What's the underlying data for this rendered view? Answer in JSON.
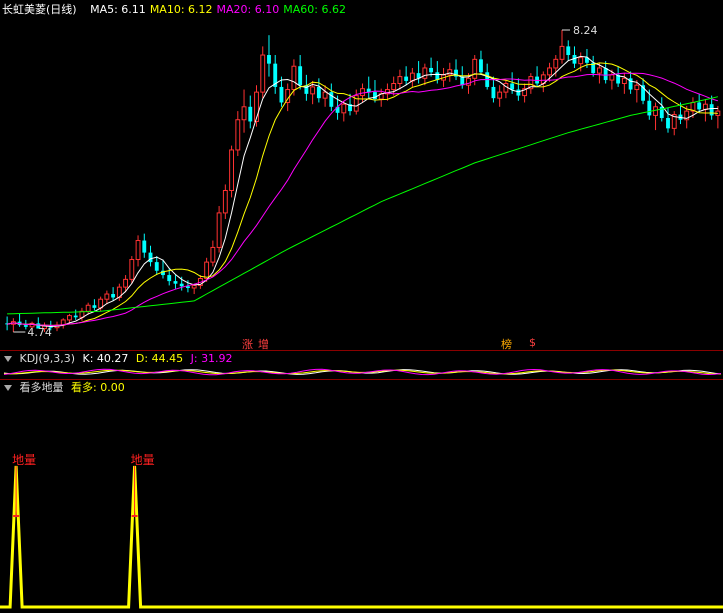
{
  "header": {
    "title": "长虹美菱(日线)",
    "ma": [
      {
        "label": "MA5",
        "value": "6.11",
        "color": "#ffffff"
      },
      {
        "label": "MA10",
        "value": "6.12",
        "color": "#ffff00"
      },
      {
        "label": "MA20",
        "value": "6.10",
        "color": "#ff00ff"
      },
      {
        "label": "MA60",
        "value": "6.62",
        "color": "#00ff00"
      }
    ]
  },
  "kdj": {
    "title": "KDJ(9,3,3)",
    "k": {
      "label": "K",
      "value": "40.27",
      "color": "#ffffff"
    },
    "d": {
      "label": "D",
      "value": "44.45",
      "color": "#ffff00"
    },
    "j": {
      "label": "J",
      "value": "31.92",
      "color": "#ff00ff"
    }
  },
  "indicator": {
    "title": "看多地量",
    "item_label": "看多",
    "item_value": "0.00",
    "signal_label": "地量"
  },
  "chart_data": [
    {
      "type": "candlestick",
      "title": "长虹美菱(日线)",
      "annotations": {
        "high": "8.24",
        "low": "4.74"
      },
      "event_labels": [
        "涨",
        "增",
        "榜",
        "$"
      ],
      "colors": {
        "up": "#ff3232",
        "down": "#00ffff",
        "ma5": "#ffffff",
        "ma10": "#ffff00",
        "ma20": "#ff00ff",
        "ma60": "#00ff00"
      },
      "ma60_approx": [
        [
          0,
          4.95
        ],
        [
          15,
          4.98
        ],
        [
          30,
          5.1
        ],
        [
          45,
          5.7
        ],
        [
          60,
          6.25
        ],
        [
          75,
          6.7
        ],
        [
          90,
          7.05
        ],
        [
          100,
          7.25
        ],
        [
          110,
          7.4
        ],
        [
          119,
          7.55
        ]
      ],
      "ohlc": [
        [
          4.84,
          4.92,
          4.76,
          4.83
        ],
        [
          4.83,
          4.9,
          4.74,
          4.86
        ],
        [
          4.86,
          4.95,
          4.8,
          4.82
        ],
        [
          4.82,
          4.88,
          4.77,
          4.8
        ],
        [
          4.8,
          4.86,
          4.74,
          4.84
        ],
        [
          4.84,
          4.91,
          4.79,
          4.78
        ],
        [
          4.78,
          4.85,
          4.74,
          4.81
        ],
        [
          4.81,
          4.87,
          4.76,
          4.79
        ],
        [
          4.79,
          4.86,
          4.75,
          4.82
        ],
        [
          4.82,
          4.9,
          4.78,
          4.88
        ],
        [
          4.88,
          4.95,
          4.84,
          4.93
        ],
        [
          4.93,
          5.0,
          4.88,
          4.91
        ],
        [
          4.91,
          5.02,
          4.87,
          4.98
        ],
        [
          4.98,
          5.08,
          4.94,
          5.05
        ],
        [
          5.05,
          5.12,
          4.99,
          5.02
        ],
        [
          5.02,
          5.15,
          4.98,
          5.12
        ],
        [
          5.12,
          5.22,
          5.06,
          5.18
        ],
        [
          5.18,
          5.26,
          5.1,
          5.14
        ],
        [
          5.14,
          5.3,
          5.1,
          5.26
        ],
        [
          5.26,
          5.4,
          5.2,
          5.35
        ],
        [
          5.35,
          5.62,
          5.3,
          5.58
        ],
        [
          5.58,
          5.86,
          5.5,
          5.8
        ],
        [
          5.8,
          5.88,
          5.6,
          5.66
        ],
        [
          5.66,
          5.74,
          5.5,
          5.55
        ],
        [
          5.55,
          5.62,
          5.4,
          5.45
        ],
        [
          5.45,
          5.58,
          5.36,
          5.4
        ],
        [
          5.4,
          5.48,
          5.28,
          5.33
        ],
        [
          5.33,
          5.4,
          5.24,
          5.3
        ],
        [
          5.3,
          5.38,
          5.22,
          5.27
        ],
        [
          5.27,
          5.34,
          5.2,
          5.25
        ],
        [
          5.25,
          5.3,
          5.18,
          5.28
        ],
        [
          5.28,
          5.4,
          5.24,
          5.36
        ],
        [
          5.36,
          5.6,
          5.32,
          5.55
        ],
        [
          5.55,
          5.8,
          5.5,
          5.72
        ],
        [
          5.72,
          6.2,
          5.66,
          6.12
        ],
        [
          6.12,
          6.45,
          6.05,
          6.38
        ],
        [
          6.38,
          6.9,
          6.3,
          6.85
        ],
        [
          6.85,
          7.3,
          6.78,
          7.2
        ],
        [
          7.2,
          7.55,
          7.05,
          7.35
        ],
        [
          7.35,
          7.48,
          7.1,
          7.18
        ],
        [
          7.18,
          7.6,
          7.12,
          7.52
        ],
        [
          7.52,
          8.05,
          7.45,
          7.95
        ],
        [
          7.95,
          8.18,
          7.7,
          7.85
        ],
        [
          7.85,
          7.95,
          7.5,
          7.58
        ],
        [
          7.58,
          7.7,
          7.35,
          7.4
        ],
        [
          7.4,
          7.62,
          7.3,
          7.55
        ],
        [
          7.55,
          7.9,
          7.48,
          7.82
        ],
        [
          7.82,
          7.95,
          7.55,
          7.6
        ],
        [
          7.6,
          7.72,
          7.42,
          7.5
        ],
        [
          7.5,
          7.65,
          7.38,
          7.58
        ],
        [
          7.58,
          7.68,
          7.4,
          7.45
        ],
        [
          7.45,
          7.6,
          7.35,
          7.52
        ],
        [
          7.52,
          7.62,
          7.3,
          7.35
        ],
        [
          7.35,
          7.48,
          7.2,
          7.28
        ],
        [
          7.28,
          7.42,
          7.18,
          7.38
        ],
        [
          7.38,
          7.5,
          7.25,
          7.3
        ],
        [
          7.3,
          7.55,
          7.26,
          7.48
        ],
        [
          7.48,
          7.62,
          7.4,
          7.56
        ],
        [
          7.56,
          7.7,
          7.45,
          7.52
        ],
        [
          7.52,
          7.66,
          7.4,
          7.44
        ],
        [
          7.44,
          7.56,
          7.35,
          7.5
        ],
        [
          7.5,
          7.62,
          7.42,
          7.55
        ],
        [
          7.55,
          7.7,
          7.48,
          7.62
        ],
        [
          7.62,
          7.78,
          7.55,
          7.7
        ],
        [
          7.7,
          7.82,
          7.6,
          7.65
        ],
        [
          7.65,
          7.8,
          7.58,
          7.74
        ],
        [
          7.74,
          7.88,
          7.62,
          7.68
        ],
        [
          7.68,
          7.85,
          7.6,
          7.8
        ],
        [
          7.8,
          7.92,
          7.7,
          7.75
        ],
        [
          7.75,
          7.88,
          7.62,
          7.66
        ],
        [
          7.66,
          7.8,
          7.58,
          7.72
        ],
        [
          7.72,
          7.86,
          7.64,
          7.78
        ],
        [
          7.78,
          7.9,
          7.66,
          7.7
        ],
        [
          7.7,
          7.82,
          7.56,
          7.6
        ],
        [
          7.6,
          7.74,
          7.5,
          7.68
        ],
        [
          7.68,
          7.95,
          7.6,
          7.9
        ],
        [
          7.9,
          8.0,
          7.72,
          7.75
        ],
        [
          7.75,
          7.85,
          7.55,
          7.58
        ],
        [
          7.58,
          7.7,
          7.4,
          7.45
        ],
        [
          7.45,
          7.6,
          7.35,
          7.52
        ],
        [
          7.52,
          7.66,
          7.45,
          7.62
        ],
        [
          7.62,
          7.75,
          7.5,
          7.55
        ],
        [
          7.55,
          7.68,
          7.42,
          7.48
        ],
        [
          7.48,
          7.62,
          7.4,
          7.56
        ],
        [
          7.56,
          7.74,
          7.5,
          7.7
        ],
        [
          7.7,
          7.82,
          7.58,
          7.62
        ],
        [
          7.62,
          7.76,
          7.52,
          7.72
        ],
        [
          7.72,
          7.86,
          7.64,
          7.8
        ],
        [
          7.8,
          7.95,
          7.7,
          7.9
        ],
        [
          7.9,
          8.24,
          7.85,
          8.05
        ],
        [
          8.05,
          8.12,
          7.88,
          7.95
        ],
        [
          7.95,
          8.05,
          7.8,
          7.85
        ],
        [
          7.85,
          7.98,
          7.76,
          7.92
        ],
        [
          7.92,
          8.02,
          7.8,
          7.86
        ],
        [
          7.86,
          7.94,
          7.7,
          7.74
        ],
        [
          7.74,
          7.86,
          7.62,
          7.8
        ],
        [
          7.8,
          7.88,
          7.62,
          7.66
        ],
        [
          7.66,
          7.78,
          7.55,
          7.72
        ],
        [
          7.72,
          7.82,
          7.58,
          7.62
        ],
        [
          7.62,
          7.74,
          7.5,
          7.68
        ],
        [
          7.68,
          7.76,
          7.5,
          7.55
        ],
        [
          7.55,
          7.66,
          7.4,
          7.6
        ],
        [
          7.6,
          7.68,
          7.38,
          7.42
        ],
        [
          7.42,
          7.55,
          7.2,
          7.25
        ],
        [
          7.25,
          7.4,
          7.08,
          7.35
        ],
        [
          7.35,
          7.46,
          7.18,
          7.22
        ],
        [
          7.22,
          7.34,
          7.05,
          7.1
        ],
        [
          7.1,
          7.3,
          7.02,
          7.26
        ],
        [
          7.26,
          7.4,
          7.15,
          7.2
        ],
        [
          7.2,
          7.36,
          7.1,
          7.3
        ],
        [
          7.3,
          7.46,
          7.22,
          7.4
        ],
        [
          7.4,
          7.5,
          7.28,
          7.32
        ],
        [
          7.32,
          7.44,
          7.18,
          7.38
        ],
        [
          7.38,
          7.48,
          7.2,
          7.25
        ],
        [
          7.25,
          7.36,
          7.1,
          7.3
        ]
      ]
    },
    {
      "type": "line",
      "title": "KDJ(9,3,3)",
      "series": [
        {
          "name": "K",
          "values": [
            40.27
          ],
          "color": "#ffffff"
        },
        {
          "name": "D",
          "values": [
            44.45
          ],
          "color": "#ffff00"
        },
        {
          "name": "J",
          "values": [
            31.92
          ],
          "color": "#ff00ff"
        }
      ]
    },
    {
      "type": "line",
      "title": "看多地量",
      "series": [
        {
          "name": "看多",
          "values": [
            0.0
          ],
          "color": "#ffff00"
        }
      ],
      "spike_days": [
        0,
        19
      ],
      "spike_label": "地量"
    }
  ]
}
